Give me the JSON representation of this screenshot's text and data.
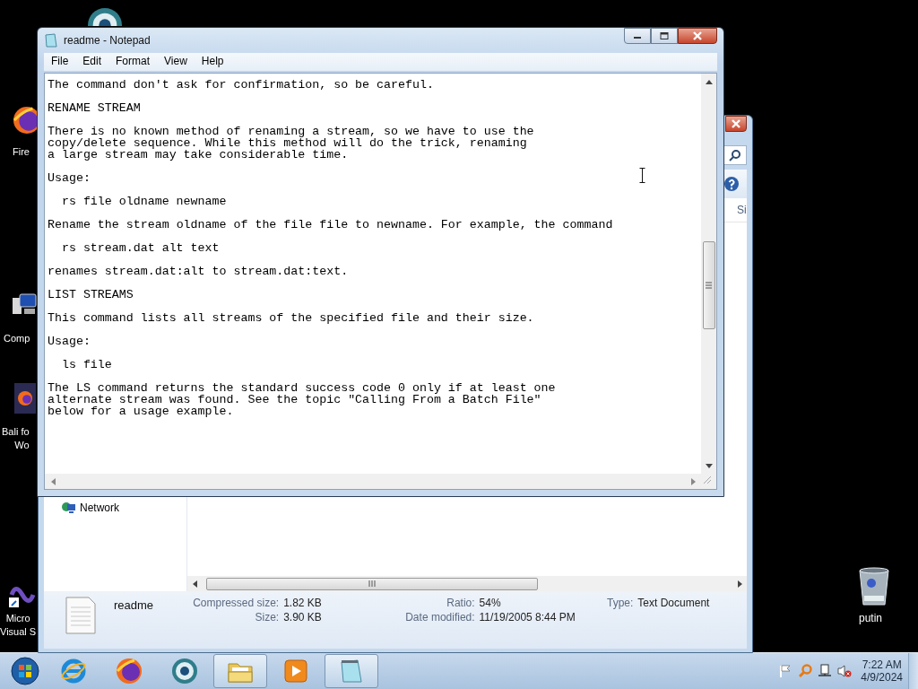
{
  "desktop": {
    "icons": [
      {
        "kind": "globe"
      },
      {
        "kind": "firefox",
        "label_lines": [
          "Fire"
        ]
      },
      {
        "kind": "computer",
        "label_lines": [
          "Comp"
        ]
      },
      {
        "kind": "firefox-doc",
        "label_lines": [
          "Bali fo",
          "Wo"
        ]
      },
      {
        "kind": "studio",
        "label_lines": [
          "Micro",
          "Visual S"
        ]
      },
      {
        "kind": "recycle",
        "label_lines": [
          "putin"
        ]
      }
    ]
  },
  "explorer": {
    "column_header": "Si",
    "nav_items": [
      {
        "label": "Network"
      }
    ],
    "details": {
      "name": "readme",
      "columns": [
        [
          {
            "label": "Compressed size:",
            "value": "1.82 KB"
          },
          {
            "label": "Size:",
            "value": "3.90 KB"
          }
        ],
        [
          {
            "label": "Ratio:",
            "value": "54%"
          },
          {
            "label": "Date modified:",
            "value": "11/19/2005 8:44 PM"
          }
        ],
        [
          {
            "label": "Type:",
            "value": "Text Document"
          }
        ]
      ]
    }
  },
  "notepad": {
    "title": "readme - Notepad",
    "menu": [
      "File",
      "Edit",
      "Format",
      "View",
      "Help"
    ],
    "paragraphs": [
      {
        "kind": "text",
        "lines": [
          "The command don't ask for confirmation, so be careful."
        ]
      },
      {
        "kind": "heading",
        "lines": [
          "RENAME STREAM"
        ]
      },
      {
        "kind": "text",
        "lines": [
          "There is no known method of renaming a stream, so we have to use the",
          "copy/delete sequence. While this method will do the trick, renaming",
          "a large stream may take considerable time."
        ]
      },
      {
        "kind": "text",
        "lines": [
          "Usage:"
        ]
      },
      {
        "kind": "command",
        "lines": [
          "rs file oldname newname"
        ]
      },
      {
        "kind": "text",
        "lines": [
          "Rename the stream oldname of the file file to newname. For example, the command"
        ]
      },
      {
        "kind": "command",
        "lines": [
          "rs stream.dat alt text"
        ]
      },
      {
        "kind": "text",
        "lines": [
          "renames stream.dat:alt to stream.dat:text."
        ]
      },
      {
        "kind": "heading",
        "lines": [
          "LIST STREAMS"
        ]
      },
      {
        "kind": "text",
        "lines": [
          "This command lists all streams of the specified file and their size."
        ]
      },
      {
        "kind": "text",
        "lines": [
          "Usage:"
        ]
      },
      {
        "kind": "command",
        "lines": [
          "ls file"
        ]
      },
      {
        "kind": "text",
        "lines": [
          "The LS command returns the standard success code 0 only if at least one",
          "alternate stream was found. See the topic \"Calling From a Batch File\"",
          "below for a usage example."
        ]
      }
    ]
  },
  "taskbar": {
    "buttons": [
      {
        "kind": "ie",
        "active": false
      },
      {
        "kind": "firefox",
        "active": false
      },
      {
        "kind": "globe",
        "active": false
      },
      {
        "kind": "folder",
        "active": true
      },
      {
        "kind": "media",
        "active": false
      },
      {
        "kind": "notepad",
        "active": true
      }
    ],
    "tray": [
      {
        "kind": "flag"
      },
      {
        "kind": "magnifier"
      },
      {
        "kind": "network"
      },
      {
        "kind": "muted"
      }
    ],
    "time": "7:22 AM",
    "date": "4/9/2024"
  }
}
